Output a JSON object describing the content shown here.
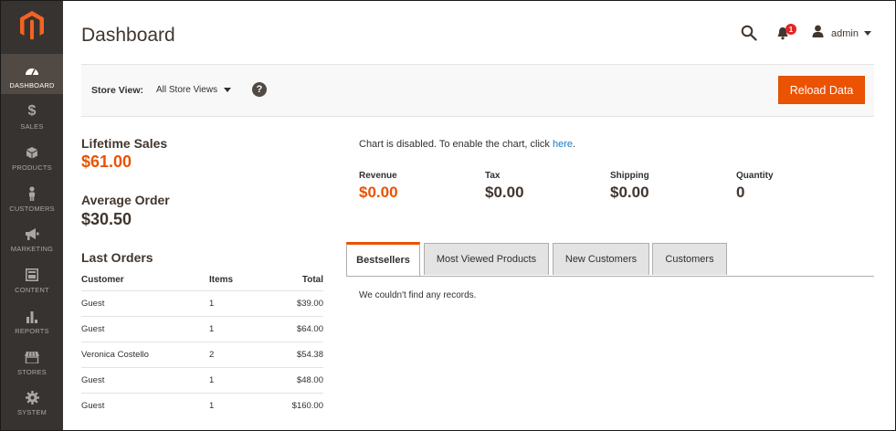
{
  "sidebar": {
    "items": [
      {
        "label": "DASHBOARD",
        "icon": "dashboard-gauge-icon",
        "active": true
      },
      {
        "label": "SALES",
        "icon": "dollar-icon",
        "active": false
      },
      {
        "label": "PRODUCTS",
        "icon": "cube-icon",
        "active": false
      },
      {
        "label": "CUSTOMERS",
        "icon": "person-icon",
        "active": false
      },
      {
        "label": "MARKETING",
        "icon": "megaphone-icon",
        "active": false
      },
      {
        "label": "CONTENT",
        "icon": "layout-icon",
        "active": false
      },
      {
        "label": "REPORTS",
        "icon": "bar-chart-icon",
        "active": false
      },
      {
        "label": "STORES",
        "icon": "storefront-icon",
        "active": false
      },
      {
        "label": "SYSTEM",
        "icon": "gear-icon",
        "active": false
      }
    ]
  },
  "header": {
    "title": "Dashboard",
    "notification_count": "1",
    "user_name": "admin"
  },
  "store_bar": {
    "label": "Store View:",
    "selected": "All Store Views",
    "reload_label": "Reload Data"
  },
  "stats": {
    "lifetime_sales_label": "Lifetime Sales",
    "lifetime_sales_value": "$61.00",
    "average_order_label": "Average Order",
    "average_order_value": "$30.50"
  },
  "last_orders": {
    "title": "Last Orders",
    "columns": [
      "Customer",
      "Items",
      "Total"
    ],
    "rows": [
      [
        "Guest",
        "1",
        "$39.00"
      ],
      [
        "Guest",
        "1",
        "$64.00"
      ],
      [
        "Veronica Costello",
        "2",
        "$54.38"
      ],
      [
        "Guest",
        "1",
        "$48.00"
      ],
      [
        "Guest",
        "1",
        "$160.00"
      ]
    ]
  },
  "chart_notice": {
    "text": "Chart is disabled. To enable the chart, click ",
    "link": "here",
    "suffix": "."
  },
  "totals": {
    "revenue_label": "Revenue",
    "revenue_value": "$0.00",
    "tax_label": "Tax",
    "tax_value": "$0.00",
    "shipping_label": "Shipping",
    "shipping_value": "$0.00",
    "quantity_label": "Quantity",
    "quantity_value": "0"
  },
  "tabs": {
    "items": [
      {
        "label": "Bestsellers",
        "active": true
      },
      {
        "label": "Most Viewed Products",
        "active": false
      },
      {
        "label": "New Customers",
        "active": false
      },
      {
        "label": "Customers",
        "active": false
      }
    ],
    "empty_message": "We couldn't find any records."
  },
  "colors": {
    "accent": "#eb5202",
    "sidebar": "#373330",
    "link": "#1979c3"
  }
}
